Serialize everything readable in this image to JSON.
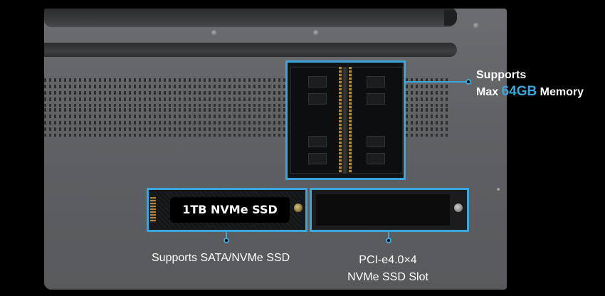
{
  "ssd": {
    "label": "1TB NVMe SSD"
  },
  "memory_callout": {
    "line1": "Supports",
    "prefix": "Max ",
    "highlight": "64GB",
    "suffix": " Memory"
  },
  "ssd_callout": {
    "text": "Supports SATA/NVMe SSD"
  },
  "slot_callout": {
    "line1": "PCI-e4.0×4",
    "line2": "NVMe SSD Slot"
  },
  "colors": {
    "accent": "#3aa6dc",
    "background": "#000000",
    "chassis": "#5e6063"
  }
}
